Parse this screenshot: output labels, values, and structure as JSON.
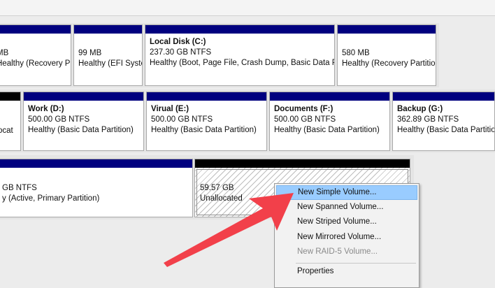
{
  "row1": [
    {
      "key": "p1",
      "name": "",
      "size": "MB",
      "status": "Healthy (Recovery Partit"
    },
    {
      "key": "p2",
      "name": "",
      "size": "99 MB",
      "status": "Healthy (EFI Syste"
    },
    {
      "key": "p3",
      "name": "Local Disk  (C:)",
      "size": "237.30 GB NTFS",
      "status": "Healthy (Boot, Page File, Crash Dump, Basic Data P"
    },
    {
      "key": "p4",
      "name": "",
      "size": "580 MB",
      "status": "Healthy (Recovery Partitio"
    }
  ],
  "row2": [
    {
      "key": "q1",
      "name": "",
      "size": "",
      "status": "ocat"
    },
    {
      "key": "q2",
      "name": "Work  (D:)",
      "size": "500.00 GB NTFS",
      "status": "Healthy (Basic Data Partition)"
    },
    {
      "key": "q3",
      "name": "Virual  (E:)",
      "size": "500.00 GB NTFS",
      "status": "Healthy (Basic Data Partition)"
    },
    {
      "key": "q4",
      "name": "Documents  (F:)",
      "size": "500.00 GB NTFS",
      "status": "Healthy (Basic Data Partition)"
    },
    {
      "key": "q5",
      "name": "Backup  (G:)",
      "size": "362.89 GB NTFS",
      "status": "Healthy (Basic Data Partition"
    }
  ],
  "row3": [
    {
      "key": "r1",
      "name": "",
      "size": "GB NTFS",
      "status": "y (Active, Primary Partition)"
    },
    {
      "key": "r2",
      "name": "",
      "size": "59.57 GB",
      "status": "Unallocated"
    }
  ],
  "context_menu": {
    "items": [
      {
        "label": "New Simple Volume...",
        "state": "highlighted"
      },
      {
        "label": "New Spanned Volume...",
        "state": "enabled"
      },
      {
        "label": "New Striped Volume...",
        "state": "enabled"
      },
      {
        "label": "New Mirrored Volume...",
        "state": "enabled"
      },
      {
        "label": "New RAID-5 Volume...",
        "state": "disabled"
      },
      {
        "label": "Properties",
        "state": "enabled"
      }
    ]
  },
  "colors": {
    "primary_bar": "#00007f",
    "unallocated_bar": "#000000",
    "menu_highlight": "#99ccff",
    "annotation_arrow": "#f2404a"
  }
}
